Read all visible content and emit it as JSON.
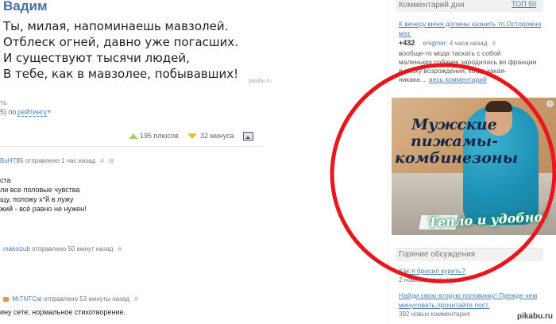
{
  "post": {
    "author": "Вадим",
    "lines": [
      "Ты, милая, напоминаешь мавзолей.",
      "Отблеск огней, давно уже погасших.",
      "И существуют тысячи людей,",
      "В тебе, как в мавзолее, побывавших!"
    ],
    "watermark": "pikabu.ru",
    "cut_text": "ть"
  },
  "sort": {
    "prefix": "5) по",
    "rating_label": "рейтингу",
    "arrow": "▾",
    "plus_label": "195 плюсов",
    "minus_label": "32 минуса"
  },
  "comments": [
    {
      "user": "BuHT85",
      "meta": "отправлено 1 час назад",
      "hash": "#",
      "extra": "⊟",
      "lines": [
        "ста",
        "ли все половые чувства",
        "щу, положу х*й в лужу",
        "жий - всё равно не нужен!"
      ]
    },
    {
      "user": "maksizub",
      "meta": "отправлено 50 минут назад",
      "hash": "#",
      "lines": []
    },
    {
      "user": "MrTNTCat",
      "meta": "отправлено 53 минуты назад",
      "hash": "#",
      "lines": [
        "ину сете, нормальное стихотворение."
      ]
    }
  ],
  "sidebar": {
    "comment_day_title": "Комментарий дня",
    "top50": "ТОП 50",
    "day_post_link_1": "К вечеру меня должны казнить тп.Осторожно",
    "day_post_link_2": "мат.",
    "day_score": "+432",
    "day_user": "enigmer",
    "day_time": "; 4 часа назад",
    "day_hash": "#",
    "day_text": [
      "вообще-то мода таскать с собой",
      "маленьких собачек зародилась во франции",
      "в эпоху возрождения, когда какая-",
      "никака..."
    ],
    "day_more": "весь комментарий",
    "discussions_title": "Горячие обсуждения",
    "discussions": [
      {
        "link": "Как я бросил курить?",
        "count": "2 новых комментария"
      },
      {
        "link": "Найди свою вторую половинку! Прежде чем",
        "link2": "минусовать,прочитайте пост.",
        "count": "392 новых комментария"
      }
    ]
  },
  "ad": {
    "title": "Мужские пижамы-комбинезоны",
    "slogan": "Тепло и удобно!",
    "info": "i"
  },
  "colors": {
    "oval": "#e8171b",
    "link": "#4a7fb5"
  },
  "footer_watermark": "pikabu.ru"
}
